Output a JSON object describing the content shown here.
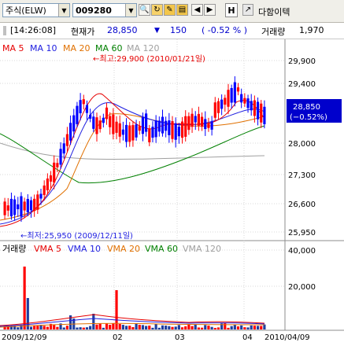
{
  "toolbar": {
    "market_select": "주식(ELW)",
    "code_input": "009280",
    "h_button": "H",
    "stock_name": "다함이텍"
  },
  "info": {
    "time": "[14:26:08]",
    "price_label": "현재가",
    "price": "28,850",
    "change_arrow": "▼",
    "change": "150",
    "change_pct": "( -0.52 % )",
    "volume_label": "거래량",
    "volume": "1,970"
  },
  "colors": {
    "up": "#ff0000",
    "down": "#0000ff",
    "ma5": "#e60000",
    "ma10": "#2020e0",
    "ma20": "#e07000",
    "ma60": "#008000",
    "ma120": "#a0a0a0"
  },
  "price_legend": {
    "ma5": "MA 5",
    "ma10": "MA 10",
    "ma20": "MA 20",
    "ma60": "MA 60",
    "ma120": "MA 120"
  },
  "volume_legend": {
    "title": "거래량",
    "vma5": "VMA 5",
    "vma10": "VMA 10",
    "vma20": "VMA 20",
    "vma60": "VMA 60",
    "vma120": "VMA 120"
  },
  "annotations": {
    "high": "←최고:29,900 (2010/01/21일)",
    "low": "←최저:25,950 (2009/12/11일)"
  },
  "price_axis": [
    "29,900",
    "29,400",
    "28,000",
    "27,300",
    "26,600",
    "25,950"
  ],
  "current_price_box": {
    "price": "28,850",
    "pct": "(−0.52%)"
  },
  "volume_axis": [
    "40,000",
    "20,000"
  ],
  "date_axis": [
    "2009/12/09",
    "02",
    "03",
    "04",
    "2010/04/09"
  ],
  "chart_data": {
    "type": "candlestick",
    "price_ylim": [
      25950,
      29900
    ],
    "volume_ylim": [
      0,
      40000
    ],
    "x_range": [
      "2009/12/09",
      "2010/04/09"
    ],
    "high": {
      "value": 29900,
      "date": "2010/01/21"
    },
    "low": {
      "value": 25950,
      "date": "2009/12/11"
    },
    "last_price": 28850
  }
}
